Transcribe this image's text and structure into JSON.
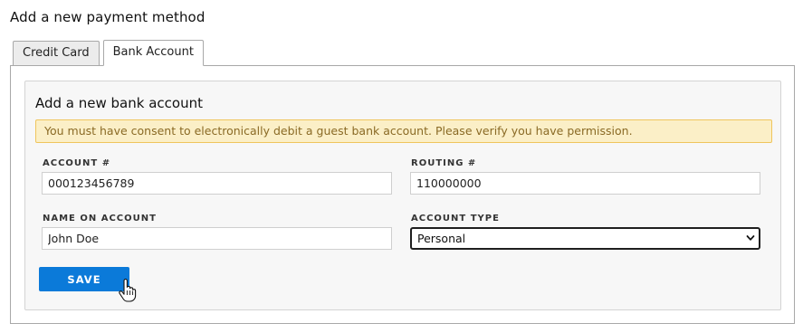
{
  "page": {
    "title": "Add a new payment method"
  },
  "tabs": [
    {
      "label": "Credit Card",
      "active": false
    },
    {
      "label": "Bank Account",
      "active": true
    }
  ],
  "bank_account": {
    "title": "Add a new bank account",
    "alert": "You must have consent to electronically debit a guest bank account. Please verify you have permission.",
    "account_number": {
      "label": "ACCOUNT #",
      "value": "000123456789"
    },
    "routing_number": {
      "label": "ROUTING #",
      "value": "110000000"
    },
    "name_on_account": {
      "label": "NAME ON ACCOUNT",
      "value": "John Doe"
    },
    "account_type": {
      "label": "ACCOUNT TYPE",
      "value": "Personal"
    },
    "save_label": "SAVE"
  },
  "colors": {
    "primary_button": "#0b7ad9",
    "alert_background": "#fbefc7",
    "alert_border": "#efc55d",
    "alert_text": "#8a6a25"
  },
  "icons": [
    "chevron-down-icon",
    "hand-pointer-cursor-icon"
  ]
}
